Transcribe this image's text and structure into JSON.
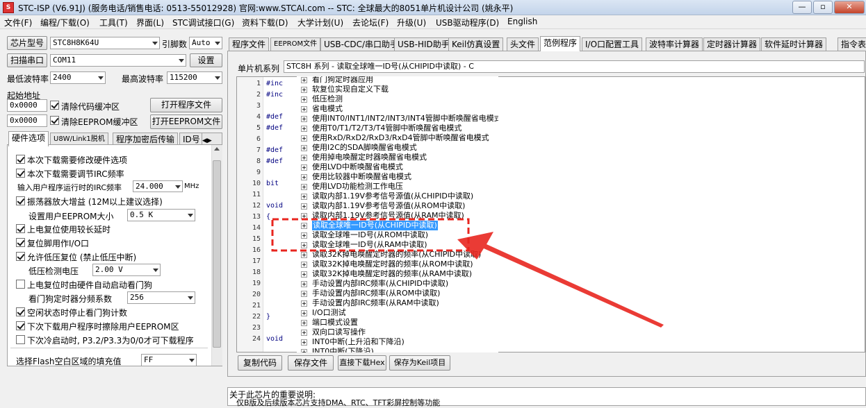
{
  "window": {
    "title": "STC-ISP (V6.91J) (服务电话/销售电话: 0513-55012928) 官网:www.STCAI.com  -- STC: 全球最大的8051单片机设计公司 (姚永平)",
    "minimize": "—",
    "restore": "▫",
    "close": "✕"
  },
  "menu": [
    "文件(F)",
    "编程/下载(O)",
    "工具(T)",
    "界面(L)",
    "STC调试接口(G)",
    "资料下载(D)",
    "大学计划(U)",
    "去论坛(F)",
    "升级(U)",
    "USB驱动程序(D)",
    "English"
  ],
  "left": {
    "chip_label": "芯片型号",
    "chip_value": "STC8H8K64U",
    "pin_label": "引脚数",
    "pin_value": "Auto",
    "scan_label": "扫描串口",
    "port_value": "COM11",
    "settings_label": "设置",
    "min_baud_label": "最低波特率",
    "min_baud_value": "2400",
    "max_baud_label": "最高波特率",
    "max_baud_value": "115200",
    "start_addr_label": "起始地址",
    "addr1": "0x0000",
    "clear_code": "清除代码缓冲区",
    "open_program": "打开程序文件",
    "addr2": "0x0000",
    "clear_eeprom": "清除EEPROM缓冲区",
    "open_eeprom": "打开EEPROM文件",
    "tabs": [
      "硬件选项",
      "U8W/Link1脱机",
      "程序加密后传输",
      "ID号"
    ],
    "hw": {
      "opt1": "本次下载需要修改硬件选项",
      "opt2": "本次下载需要调节IRC频率",
      "irc_label": "输入用户程序运行时的IRC频率",
      "irc_value": "24.000",
      "irc_unit": "MHz",
      "opt3": "振荡器放大增益 (12M以上建议选择)",
      "eeprom_label": "设置用户EEPROM大小",
      "eeprom_value": "0.5 K",
      "opt4": "上电复位使用较长延时",
      "opt5": "复位脚用作I/O口",
      "opt6": "允许低压复位 (禁止低压中断)",
      "lv_label": "低压检测电压",
      "lv_value": "2.00 V",
      "opt7": "上电复位时由硬件自动启动看门狗",
      "wdt_label": "看门狗定时器分频系数",
      "wdt_value": "256",
      "opt8": "空闲状态时停止看门狗计数",
      "opt9": "下次下载用户程序时擦除用户EEPROM区",
      "opt10": "下次冷启动时, P3.2/P3.3为0/0才可下载程序",
      "fill_label": "选择Flash空白区域的填充值",
      "fill_value": "FF"
    }
  },
  "right": {
    "tabs": [
      "程序文件",
      "EEPROM文件",
      "USB-CDC/串口助手",
      "USB-HID助手",
      "Keil仿真设置",
      "头文件",
      "范例程序",
      "I/O口配置工具",
      "波特率计算器",
      "定时器计算器",
      "软件延时计算器",
      "指令表"
    ],
    "series_label": "单片机系列",
    "series_value": "STC8H 系列 - 读取全球唯一ID号(从CHIPID中读取) - C",
    "line_numbers": [
      "1",
      "2",
      "3",
      "4",
      "5",
      "6",
      "7",
      "8",
      "9",
      "10",
      "11",
      "12",
      "13",
      "14",
      "15",
      "16",
      "17",
      "18",
      "19",
      "20",
      "21",
      "22",
      "23",
      "24"
    ],
    "code_lines": {
      "1": "#inc",
      "2": "#inc",
      "4": "#def",
      "5": "#def",
      "7": "#def",
      "8": "#def",
      "10": "bit",
      "12": "void",
      "13": "{",
      "22": "}",
      "24": "void"
    },
    "tree_items": [
      "看门狗定时器应用",
      "软复位实现自定义下载",
      "低压检测",
      "省电模式",
      "使用INT0/INT1/INT2/INT3/INT4管脚中断唤醒省电模式",
      "使用T0/T1/T2/T3/T4管脚中断唤醒省电模式",
      "使用RxD/RxD2/RxD3/RxD4管脚中断唤醒省电模式",
      "使用I2C的SDA脚唤醒省电模式",
      "使用掉电唤醒定时器唤醒省电模式",
      "使用LVD中断唤醒省电模式",
      "使用比较器中断唤醒省电模式",
      "使用LVD功能检测工作电压",
      "读取内部1.19V参考信号源值(从CHIPID中读取)",
      "读取内部1.19V参考信号源值(从ROM中读取)",
      "读取内部1.19V参考信号源值(从RAM中读取)",
      "读取全球唯一ID号(从CHIPID中读取)",
      "读取全球唯一ID号(从ROM中读取)",
      "读取全球唯一ID号(从RAM中读取)",
      "读取32K掉电唤醒定时器的频率(从CHIPID中读取)",
      "读取32K掉电唤醒定时器的频率(从ROM中读取)",
      "读取32K掉电唤醒定时器的频率(从RAM中读取)",
      "手动设置内部IRC频率(从CHIPID中读取)",
      "手动设置内部IRC频率(从ROM中读取)",
      "手动设置内部IRC频率(从RAM中读取)",
      "I/O口测试",
      "端口模式设置",
      "双向口读写操作",
      "INT0中断(上升沿和下降沿)",
      "INT0中断(下降沿)"
    ],
    "buttons": [
      "复制代码",
      "保存文件",
      "直接下载Hex",
      "保存为Keil项目"
    ],
    "info_title": "关于此芯片的重要说明:",
    "info_line": "仅B版及后续版本芯片支持DMA、RTC、TFT彩屏控制等功能"
  },
  "colors": {
    "highlight": "#3399ff",
    "callout": "#e8261f"
  }
}
